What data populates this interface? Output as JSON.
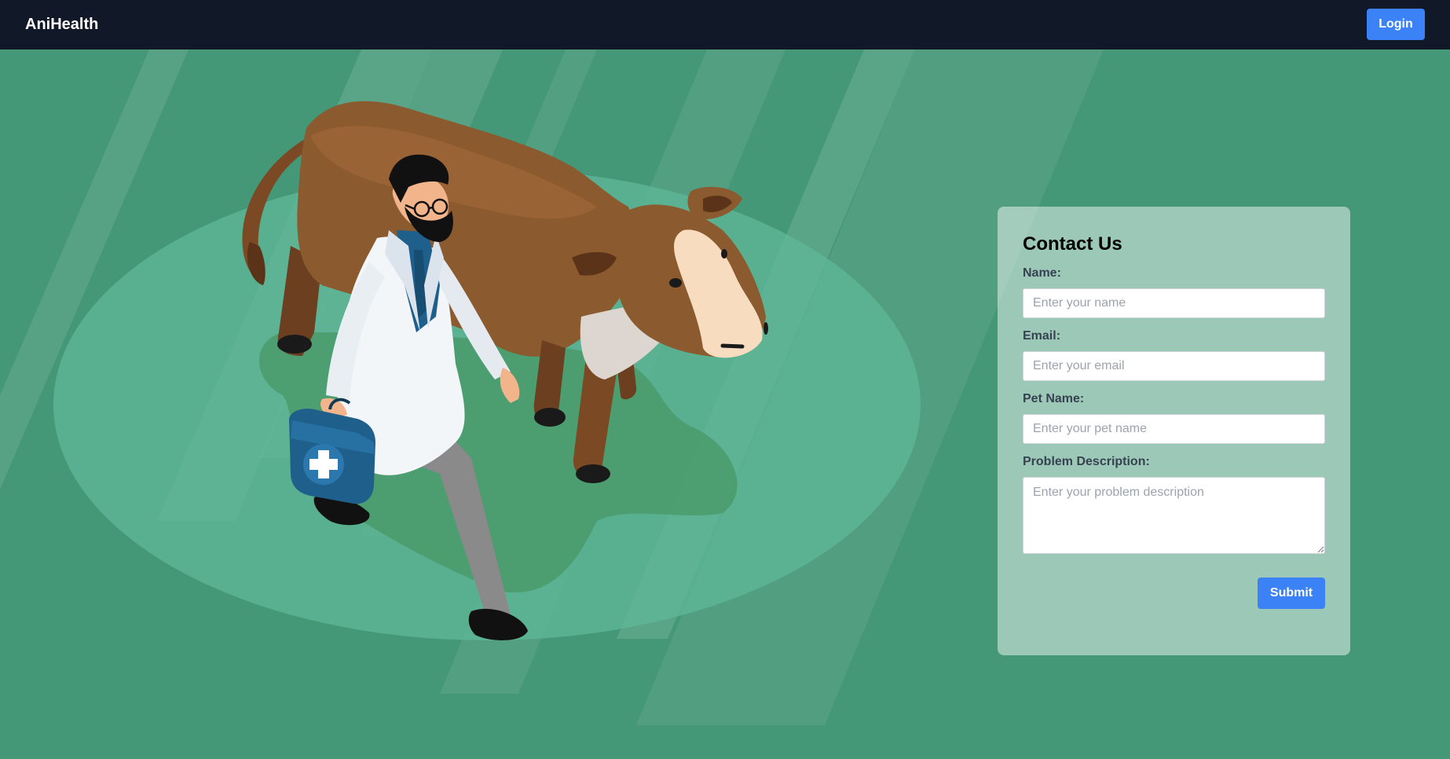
{
  "navbar": {
    "brand": "AniHealth",
    "login_label": "Login"
  },
  "hero": {
    "illustration": "veterinarian-with-cow",
    "accent_colors": {
      "background": "#449877",
      "navbar": "#111827",
      "button": "#3b82f6"
    }
  },
  "contact_form": {
    "title": "Contact Us",
    "fields": [
      {
        "label": "Name:",
        "placeholder": "Enter your name",
        "value": ""
      },
      {
        "label": "Email:",
        "placeholder": "Enter your email",
        "value": ""
      },
      {
        "label": "Pet Name:",
        "placeholder": "Enter your pet name",
        "value": ""
      },
      {
        "label": "Problem Description:",
        "placeholder": "Enter your problem description",
        "value": ""
      }
    ],
    "submit_label": "Submit"
  }
}
